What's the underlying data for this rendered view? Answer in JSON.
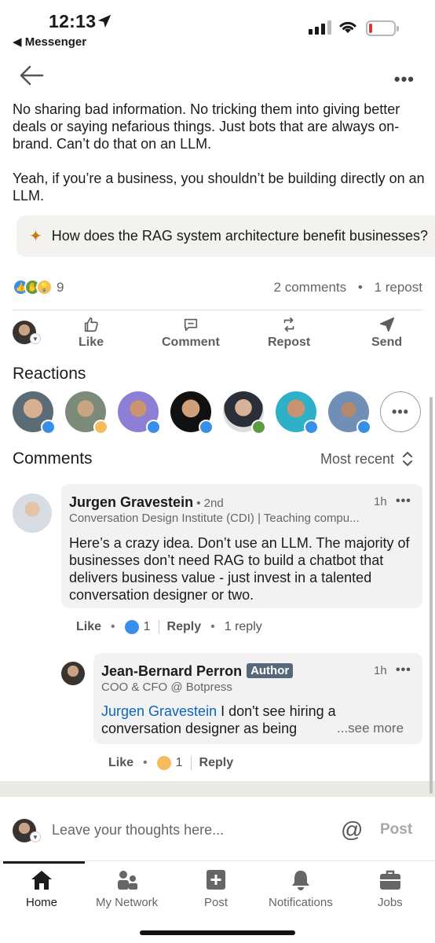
{
  "status_bar": {
    "time": "12:13",
    "back_app": "◀ Messenger"
  },
  "post": {
    "paragraphs": [
      "No sharing bad information. No tricking them into giving better deals or saying nefarious things. Just bots that are always on-brand. Can’t do that on an LLM.",
      "Yeah, if you’re a business, you shouldn’t be building directly on an LLM."
    ],
    "ai_prompt": "How does the RAG system architecture benefit businesses?",
    "reaction_count": "9",
    "comments_count": "2 comments",
    "separator": "•",
    "repost_count": "1 repost"
  },
  "actions": {
    "like": "Like",
    "comment": "Comment",
    "repost": "Repost",
    "send": "Send"
  },
  "reactions_section": {
    "title": "Reactions",
    "more": "•••"
  },
  "comments_section": {
    "title": "Comments",
    "sort_label": "Most recent"
  },
  "comments": [
    {
      "name": "Jurgen Gravestein",
      "degree": " • 2nd",
      "subtitle": "Conversation Design Institute (CDI) | Teaching compu...",
      "time": "1h",
      "more": "•••",
      "text": "Here’s a crazy idea. Don’t use an LLM. The majority of businesses don’t need RAG to build a chatbot that delivers business value - just invest in a talented conversation designer or two.",
      "like_label": "Like",
      "reaction_count": "1",
      "reply_label": "Reply",
      "replies": "1 reply"
    },
    {
      "name": "Jean-Bernard Perron",
      "badge": "Author",
      "subtitle": "COO & CFO @ Botpress",
      "time": "1h",
      "more": "•••",
      "mention": "Jurgen Gravestein",
      "text_line1": " I don't see hiring a",
      "text_line2": "conversation designer as being",
      "see_more": "...see more",
      "like_label": "Like",
      "reaction_count": "1",
      "reply_label": "Reply"
    }
  ],
  "composer": {
    "placeholder": "Leave your thoughts here...",
    "at_symbol": "@",
    "post_label": "Post"
  },
  "tabs": [
    {
      "label": "Home",
      "icon": "home-icon",
      "active": true
    },
    {
      "label": "My Network",
      "icon": "network-icon"
    },
    {
      "label": "Post",
      "icon": "post-icon"
    },
    {
      "label": "Notifications",
      "icon": "bell-icon"
    },
    {
      "label": "Jobs",
      "icon": "briefcase-icon"
    }
  ],
  "colors": {
    "like_blue": "#378fe9",
    "support_green": "#5f9b41",
    "insight_yellow": "#f5bb5c",
    "link_blue": "#0a66c2",
    "author_badge": "#56687a"
  }
}
